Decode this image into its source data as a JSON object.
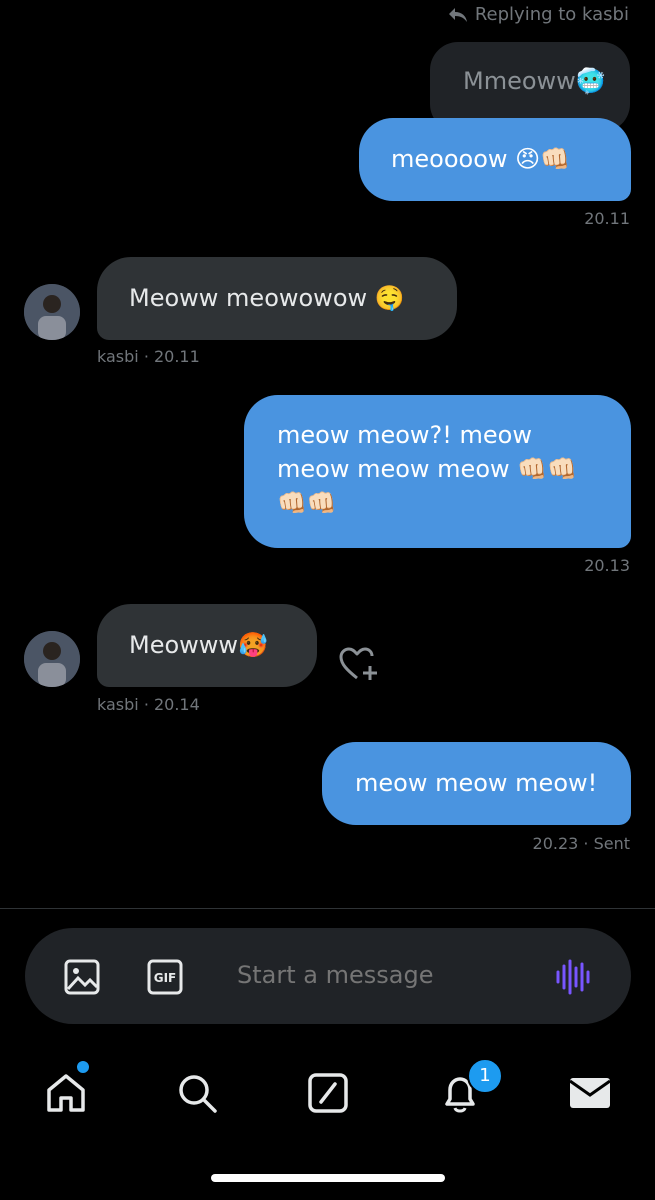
{
  "reply_note": "Replying to kasbi",
  "messages": [
    {
      "from": "me",
      "text": "Mmeoww🥶",
      "quoted": true
    },
    {
      "from": "me",
      "text": "meoooow 😠👊🏻",
      "time": "20.11"
    },
    {
      "from": "kasbi",
      "text": "Meoww meowowow 🤤",
      "meta": "kasbi · 20.11"
    },
    {
      "from": "me",
      "text": "meow meow?! meow meow meow meow 👊🏻👊🏻👊🏻👊🏻",
      "time": "20.13"
    },
    {
      "from": "kasbi",
      "text": "Meowww🥵",
      "meta": "kasbi · 20.14"
    },
    {
      "from": "me",
      "text": "meow meow meow!",
      "time": "20.23 · Sent"
    }
  ],
  "composer": {
    "placeholder": "Start a message"
  },
  "icons": [
    "reply-icon",
    "heart-add-icon",
    "image-icon",
    "gif-icon",
    "voice-icon",
    "home-icon",
    "search-icon",
    "compose-icon",
    "bell-icon",
    "mail-icon"
  ],
  "tabs": {
    "notifications_badge": "1"
  },
  "colors": {
    "sent_bubble": "#4a94e0",
    "received_bubble": "#2f3336",
    "accent": "#1d9bf0",
    "voice": "#7856ff"
  }
}
